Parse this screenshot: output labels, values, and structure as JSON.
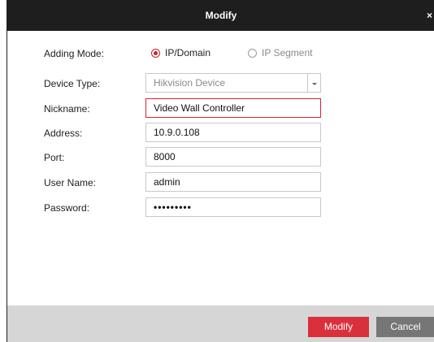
{
  "dialog": {
    "title": "Modify",
    "close_symbol": "×"
  },
  "form": {
    "adding_mode": {
      "label": "Adding Mode:",
      "options": [
        {
          "label": "IP/Domain",
          "selected": true
        },
        {
          "label": "IP Segment",
          "selected": false
        }
      ]
    },
    "device_type": {
      "label": "Device Type:",
      "value": "Hikvision Device"
    },
    "nickname": {
      "label": "Nickname:",
      "value": "Video Wall Controller"
    },
    "address": {
      "label": "Address:",
      "value": "10.9.0.108"
    },
    "port": {
      "label": "Port:",
      "value": "8000"
    },
    "user_name": {
      "label": "User Name:",
      "value": "admin"
    },
    "password": {
      "label": "Password:",
      "value": "•••••••••"
    }
  },
  "footer": {
    "modify_label": "Modify",
    "cancel_label": "Cancel"
  },
  "colors": {
    "accent": "#d9303c",
    "titlebar": "#1e1e1e",
    "footer": "#d6d6d6",
    "cancel": "#767676"
  },
  "icons": {
    "close": "close-icon",
    "dropdown": "chevron-down-icon",
    "radio_on": "radio-selected-icon",
    "radio_off": "radio-unselected-icon"
  }
}
